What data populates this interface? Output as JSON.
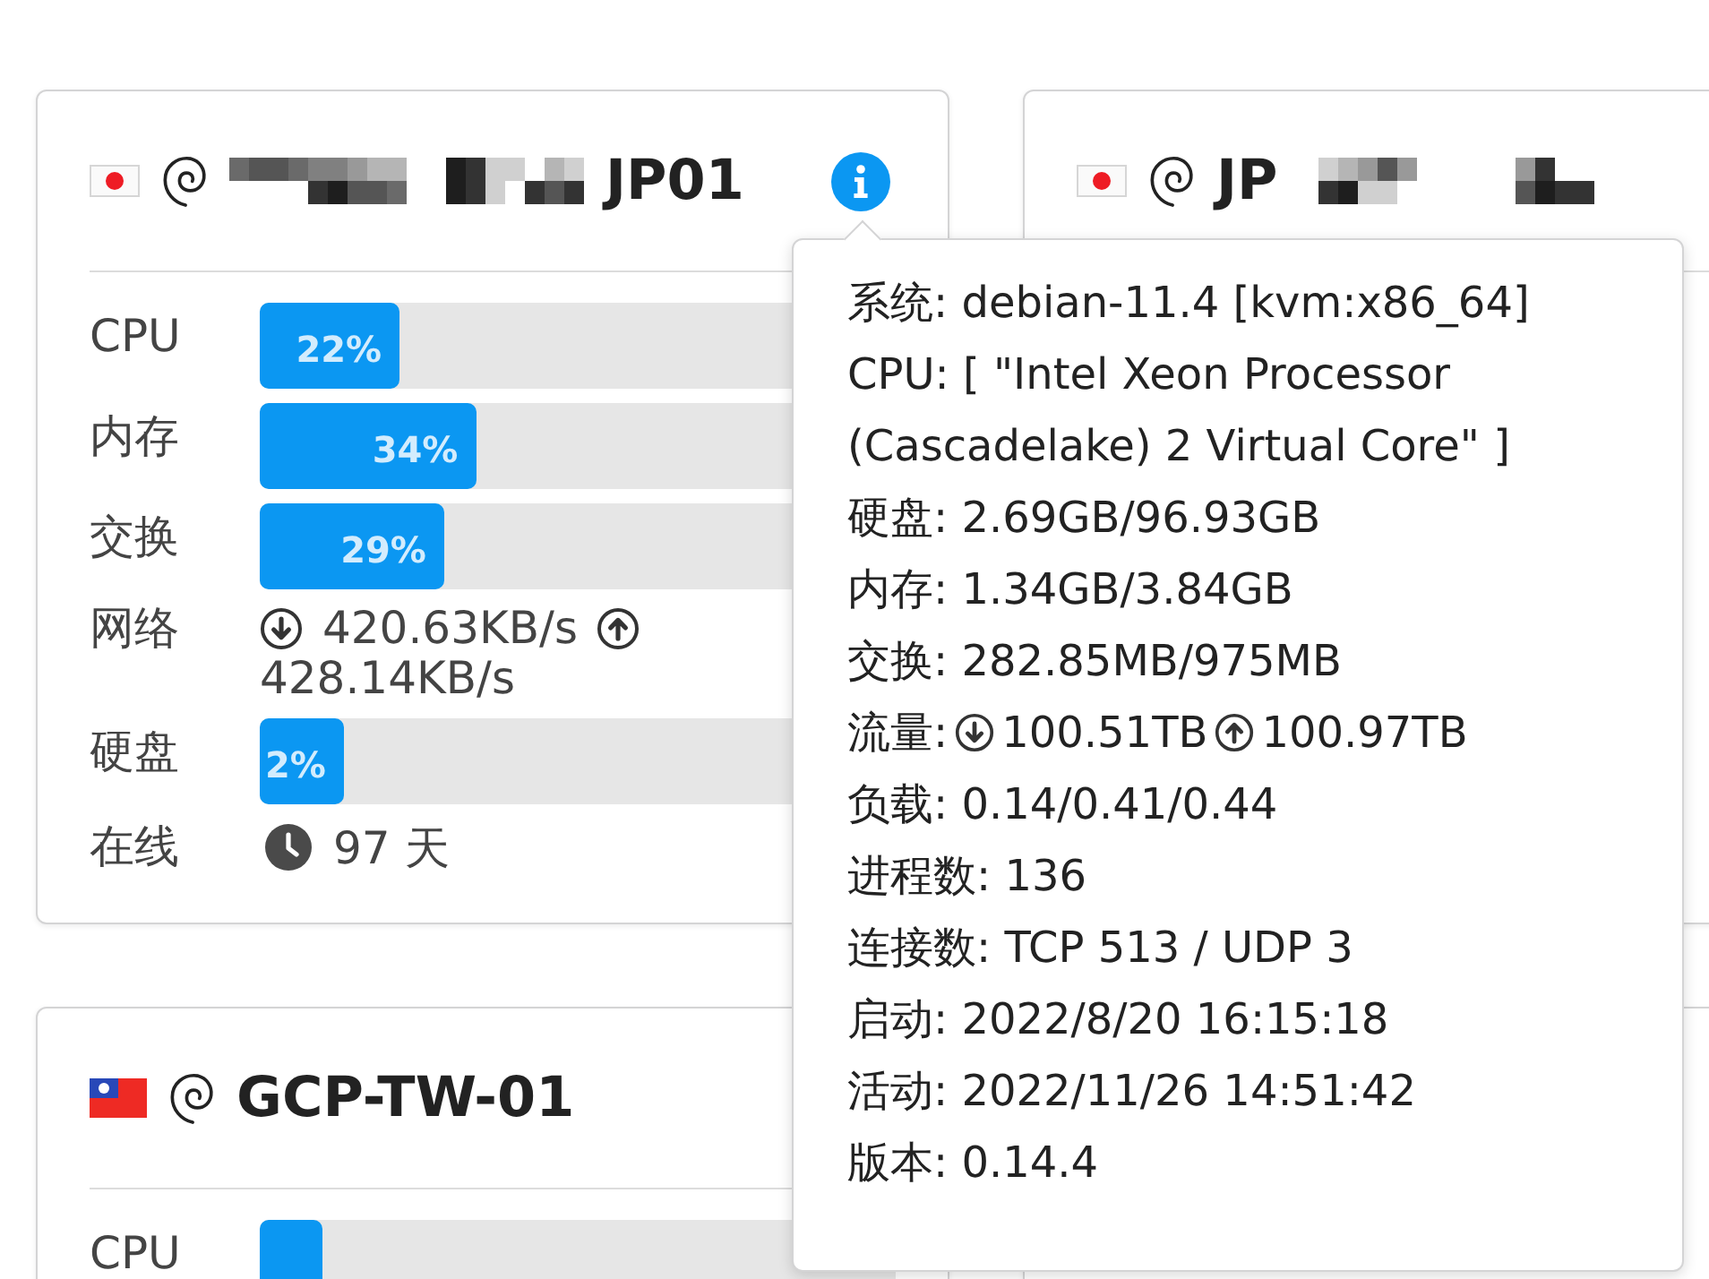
{
  "servers": [
    {
      "flag": {
        "kind": "jp"
      },
      "title_parts": [
        {
          "kind": "mosaic"
        },
        {
          "kind": "name",
          "text": "JP01"
        }
      ],
      "info_button": true,
      "rows": [
        {
          "kind": "bar",
          "label": "CPU",
          "level": 0.22,
          "reading": "22%"
        },
        {
          "kind": "bar",
          "label": "内存",
          "level": 0.34,
          "reading": "34%"
        },
        {
          "kind": "bar",
          "label": "交换",
          "level": 0.29,
          "reading": "29%"
        },
        {
          "kind": "network",
          "label": "网络",
          "down": "420.63KB/s",
          "up": "428.14KB/s"
        },
        {
          "kind": "bar",
          "label": "硬盘",
          "level": 0.02,
          "reading": "2%"
        },
        {
          "kind": "uptime",
          "label": "在线",
          "value": "97 天"
        }
      ],
      "tooltip": {
        "lines": [
          {
            "kind": "text",
            "text": "系统: debian-11.4 [kvm:x86_64]"
          },
          {
            "kind": "text",
            "text": "CPU: [ \"Intel Xeon Processor (Cascadelake) 2 Virtual Core\" ]"
          },
          {
            "kind": "text",
            "text": "硬盘: 2.69GB/96.93GB"
          },
          {
            "kind": "text",
            "text": "内存: 1.34GB/3.84GB"
          },
          {
            "kind": "text",
            "text": "交换: 282.85MB/975MB"
          },
          {
            "kind": "traffic",
            "label": "流量:",
            "down": "100.51TB",
            "up": "100.97TB"
          },
          {
            "kind": "text",
            "text": "负载: 0.14/0.41/0.44"
          },
          {
            "kind": "text",
            "text": "进程数: 136"
          },
          {
            "kind": "text",
            "text": "连接数: TCP 513 / UDP 3"
          },
          {
            "kind": "text",
            "text": "启动: 2022/8/20 16:15:18"
          },
          {
            "kind": "text",
            "text": "活动: 2022/11/26 14:51:42"
          },
          {
            "kind": "text",
            "text": "版本: 0.14.4"
          }
        ]
      }
    },
    {
      "flag": {
        "kind": "jp"
      },
      "title_parts": [
        {
          "kind": "name",
          "text": "JP"
        },
        {
          "kind": "mosaic"
        }
      ]
    },
    {
      "flag": {
        "kind": "tw"
      },
      "title_parts": [
        {
          "kind": "name",
          "text": "GCP-TW-01"
        }
      ],
      "rows": [
        {
          "kind": "bar",
          "label": "CPU",
          "level": 0.01
        }
      ]
    }
  ]
}
